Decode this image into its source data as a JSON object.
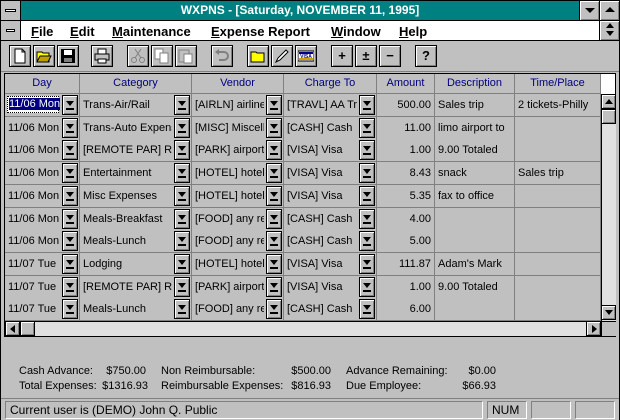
{
  "window": {
    "title": "WXPNS - [Saturday, NOVEMBER 11, 1995]"
  },
  "menu": {
    "items": [
      "File",
      "Edit",
      "Maintenance",
      "Expense Report",
      "Window",
      "Help"
    ]
  },
  "toolbar": {
    "buttons": [
      "new-icon",
      "open-icon",
      "save-icon",
      "print-icon",
      "cut-icon",
      "copy-icon",
      "paste-icon",
      "undo-icon",
      "open-folder-icon",
      "pen-icon",
      "visa-icon",
      "add",
      "plus-minus",
      "subtract",
      "help"
    ],
    "visa_label": "VISA",
    "add_label": "+",
    "plusminus_label": "±",
    "subtract_label": "−",
    "help_label": "?"
  },
  "grid": {
    "columns": [
      "Day",
      "Category",
      "Vendor",
      "Charge To",
      "Amount",
      "Description",
      "Time/Place"
    ],
    "rows": [
      {
        "day": "11/06 Mon",
        "category": "Trans-Air/Rail",
        "vendor": "[AIRLN] airlines",
        "charge": "[TRAVL] AA Tr",
        "amount": "500.00",
        "description": "Sales trip",
        "place": "2 tickets-Philly"
      },
      {
        "day": "11/06 Mon",
        "category": "Trans-Auto Expense",
        "vendor": "[MISC] Miscellaneous",
        "charge": "[CASH] Cash",
        "amount": "11.00",
        "description": "limo airport to",
        "place": ""
      },
      {
        "day": "11/06 Mon",
        "category": "[REMOTE PAR] Remote",
        "vendor": "[PARK] airport",
        "charge": "[VISA] Visa",
        "amount": "1.00",
        "description": "9.00 Totaled",
        "place": ""
      },
      {
        "day": "11/06 Mon",
        "category": "Entertainment",
        "vendor": "[HOTEL] hotels",
        "charge": "[VISA] Visa",
        "amount": "8.43",
        "description": "snack",
        "place": "Sales trip"
      },
      {
        "day": "11/06 Mon",
        "category": "Misc Expenses",
        "vendor": "[HOTEL] hotels",
        "charge": "[VISA] Visa",
        "amount": "5.35",
        "description": "fax to office",
        "place": ""
      },
      {
        "day": "11/06 Mon",
        "category": "Meals-Breakfast",
        "vendor": "[FOOD] any rest",
        "charge": "[CASH] Cash",
        "amount": "4.00",
        "description": "",
        "place": ""
      },
      {
        "day": "11/06 Mon",
        "category": "Meals-Lunch",
        "vendor": "[FOOD] any rest",
        "charge": "[CASH] Cash",
        "amount": "5.00",
        "description": "",
        "place": ""
      },
      {
        "day": "11/07 Tue",
        "category": "Lodging",
        "vendor": "[HOTEL] hotels",
        "charge": "[VISA] Visa",
        "amount": "111.87",
        "description": "Adam's Mark",
        "place": ""
      },
      {
        "day": "11/07 Tue",
        "category": "[REMOTE PAR] Remote",
        "vendor": "[PARK] airport",
        "charge": "[VISA] Visa",
        "amount": "1.00",
        "description": "9.00 Totaled",
        "place": ""
      },
      {
        "day": "11/07 Tue",
        "category": "Meals-Lunch",
        "vendor": "[FOOD] any rest",
        "charge": "[CASH] Cash",
        "amount": "6.00",
        "description": "",
        "place": ""
      }
    ]
  },
  "summary": {
    "cash_advance_label": "Cash Advance:",
    "cash_advance": "$750.00",
    "total_label": "Total Expenses:",
    "total": "$1316.93",
    "nonreimb_label": "Non Reimbursable:",
    "nonreimb": "$500.00",
    "reimb_label": "Reimbursable Expenses:",
    "reimb": "$816.93",
    "adv_rem_label": "Advance Remaining:",
    "adv_rem": "$0.00",
    "due_label": "Due Employee:",
    "due": "$66.93"
  },
  "status": {
    "user": "Current user is (DEMO) John Q. Public",
    "num": "NUM"
  }
}
